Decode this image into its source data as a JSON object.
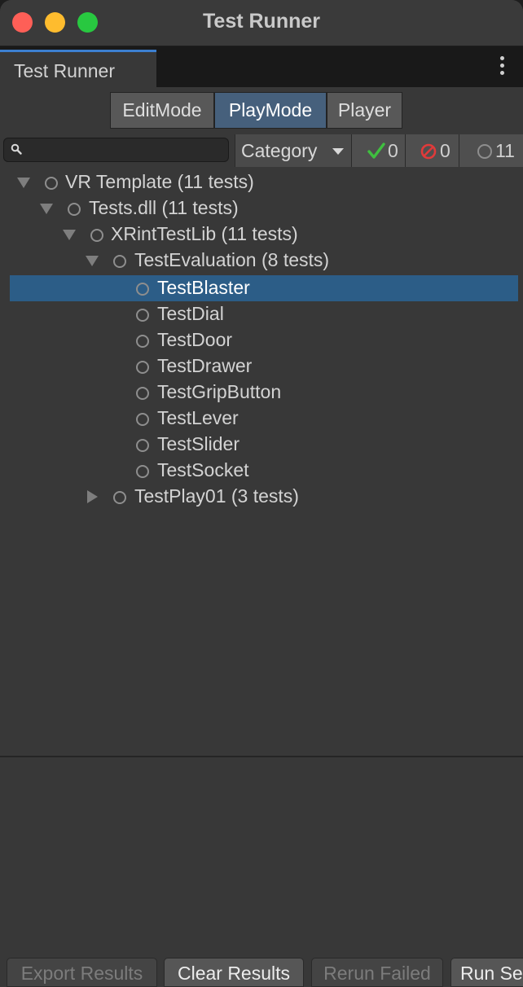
{
  "window": {
    "title": "Test Runner"
  },
  "tab": {
    "label": "Test Runner"
  },
  "modes": [
    {
      "label": "EditMode",
      "active": false
    },
    {
      "label": "PlayMode",
      "active": true
    },
    {
      "label": "Player",
      "active": false
    }
  ],
  "toolbar": {
    "search_placeholder": "",
    "category_label": "Category",
    "passed_count": "0",
    "failed_count": "0",
    "notrun_count": "11"
  },
  "tree": [
    {
      "label": "VR Template (11 tests)",
      "depth": 0,
      "expander": "expanded",
      "selected": false
    },
    {
      "label": "Tests.dll (11 tests)",
      "depth": 1,
      "expander": "expanded",
      "selected": false
    },
    {
      "label": "XRintTestLib (11 tests)",
      "depth": 2,
      "expander": "expanded",
      "selected": false
    },
    {
      "label": "TestEvaluation (8 tests)",
      "depth": 3,
      "expander": "expanded",
      "selected": false
    },
    {
      "label": "TestBlaster",
      "depth": 4,
      "expander": "none",
      "selected": true
    },
    {
      "label": "TestDial",
      "depth": 4,
      "expander": "none",
      "selected": false
    },
    {
      "label": "TestDoor",
      "depth": 4,
      "expander": "none",
      "selected": false
    },
    {
      "label": "TestDrawer",
      "depth": 4,
      "expander": "none",
      "selected": false
    },
    {
      "label": "TestGripButton",
      "depth": 4,
      "expander": "none",
      "selected": false
    },
    {
      "label": "TestLever",
      "depth": 4,
      "expander": "none",
      "selected": false
    },
    {
      "label": "TestSlider",
      "depth": 4,
      "expander": "none",
      "selected": false
    },
    {
      "label": "TestSocket",
      "depth": 4,
      "expander": "none",
      "selected": false
    },
    {
      "label": "TestPlay01 (3 tests)",
      "depth": 3,
      "expander": "collapsed",
      "selected": false
    }
  ],
  "bottom": {
    "export_label": "Export Results",
    "clear_label": "Clear Results",
    "rerun_label": "Rerun Failed",
    "run_selected_label": "Run Se"
  },
  "colors": {
    "accent": "#3c7fd0",
    "selection": "#2c5d87",
    "pass": "#3fbf3f",
    "fail": "#e03a3a"
  },
  "icons": [
    "search-icon",
    "check-icon",
    "failed-icon",
    "not-run-icon",
    "kebab-menu-icon",
    "expand-arrow-icon",
    "collapse-arrow-icon",
    "test-status-icon"
  ]
}
